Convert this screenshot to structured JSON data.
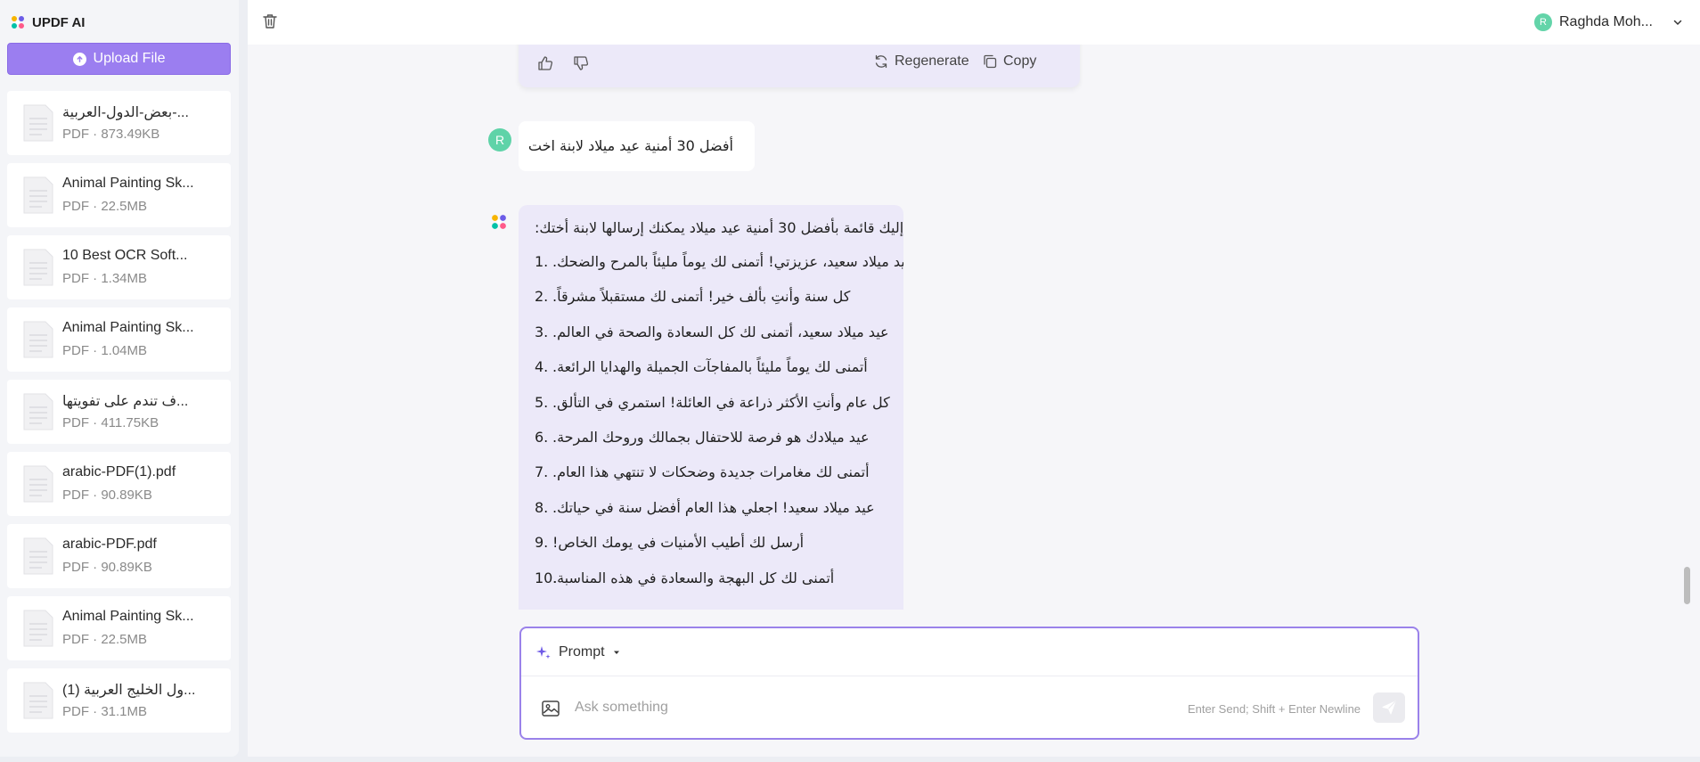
{
  "sidebar": {
    "brand_title": "UPDF AI",
    "upload_label": "Upload File",
    "files": [
      {
        "name": "بعض-الدول-العربية-...",
        "meta": "PDF · 873.49KB"
      },
      {
        "name": "Animal Painting Sk...",
        "meta": "PDF · 22.5MB"
      },
      {
        "name": "10 Best OCR Soft...",
        "meta": "PDF · 1.34MB"
      },
      {
        "name": "Animal Painting Sk...",
        "meta": "PDF · 1.04MB"
      },
      {
        "name": "ف تندم على تفويتها...",
        "meta": "PDF · 411.75KB"
      },
      {
        "name": "arabic-PDF(1).pdf",
        "meta": "PDF · 90.89KB"
      },
      {
        "name": "arabic-PDF.pdf",
        "meta": "PDF · 90.89KB"
      },
      {
        "name": "Animal Painting Sk...",
        "meta": "PDF · 22.5MB"
      },
      {
        "name": "ول الخليج العربية (1)...",
        "meta": "PDF · 31.1MB"
      }
    ]
  },
  "topbar": {
    "user_initial": "R",
    "user_name": "Raghda Moh..."
  },
  "chat": {
    "actions": {
      "regenerate_label": "Regenerate",
      "copy_label": "Copy"
    },
    "user_initial": "R",
    "user_message": "أفضل 30 أمنية عيد ميلاد لابنة اخت",
    "ai_intro": ":إليك قائمة بأفضل 30 أمنية عيد ميلاد يمكنك إرسالها لابنة أختك",
    "ai_items": [
      {
        "num": "1.",
        "text": ".عيد ميلاد سعيد، عزيزتي! أتمنى لك يوماً مليئاً بالمرح والضحك"
      },
      {
        "num": "2.",
        "text": ".كل سنة وأنتِ بألف خير! أتمنى لك مستقبلاً مشرقاً"
      },
      {
        "num": "3.",
        "text": ".عيد ميلاد سعيد، أتمنى لك كل السعادة والصحة في العالم"
      },
      {
        "num": "4.",
        "text": ".أتمنى لك يوماً مليئاً بالمفاجآت الجميلة والهدايا الرائعة"
      },
      {
        "num": "5.",
        "text": ".كل عام وأنتِ الأكثر ذراعة في العائلة! استمري في التألق"
      },
      {
        "num": "6.",
        "text": ".عيد ميلادك هو فرصة للاحتفال بجمالك وروحك المرحة"
      },
      {
        "num": "7.",
        "text": ".أتمنى لك مغامرات جديدة وضحكات لا تنتهي هذا العام"
      },
      {
        "num": "8.",
        "text": ".عيد ميلاد سعيد! اجعلي هذا العام أفضل سنة في حياتك"
      },
      {
        "num": "9.",
        "text": "!أرسل لك أطيب الأمنيات في يومك الخاص"
      },
      {
        "num": "10.",
        "text": ".أتمنى لك كل البهجة والسعادة في هذه المناسبة"
      }
    ]
  },
  "composer": {
    "prompt_label": "Prompt",
    "placeholder": "Ask something",
    "hint": "Enter Send; Shift + Enter Newline"
  }
}
